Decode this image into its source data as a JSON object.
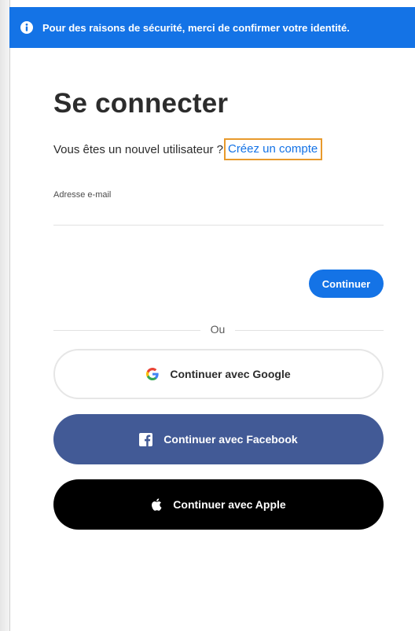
{
  "banner": {
    "icon": "info-icon",
    "text": "Pour des raisons de sécurité, merci de confirmer votre identité."
  },
  "page": {
    "title": "Se connecter",
    "subtitle_prefix": "Vous êtes un nouvel utilisateur ?",
    "create_account_link": "Créez un compte"
  },
  "form": {
    "email_label": "Adresse e-mail",
    "email_value": "",
    "continue_label": "Continuer"
  },
  "divider": {
    "text": "Ou"
  },
  "social": {
    "google": {
      "label": "Continuer avec Google",
      "icon": "google-icon"
    },
    "facebook": {
      "label": "Continuer avec Facebook",
      "icon": "facebook-icon"
    },
    "apple": {
      "label": "Continuer avec Apple",
      "icon": "apple-icon"
    }
  },
  "colors": {
    "primary_blue": "#1473e6",
    "facebook_blue": "#425a96",
    "apple_black": "#000000",
    "highlight_outline": "#e89a2c"
  }
}
